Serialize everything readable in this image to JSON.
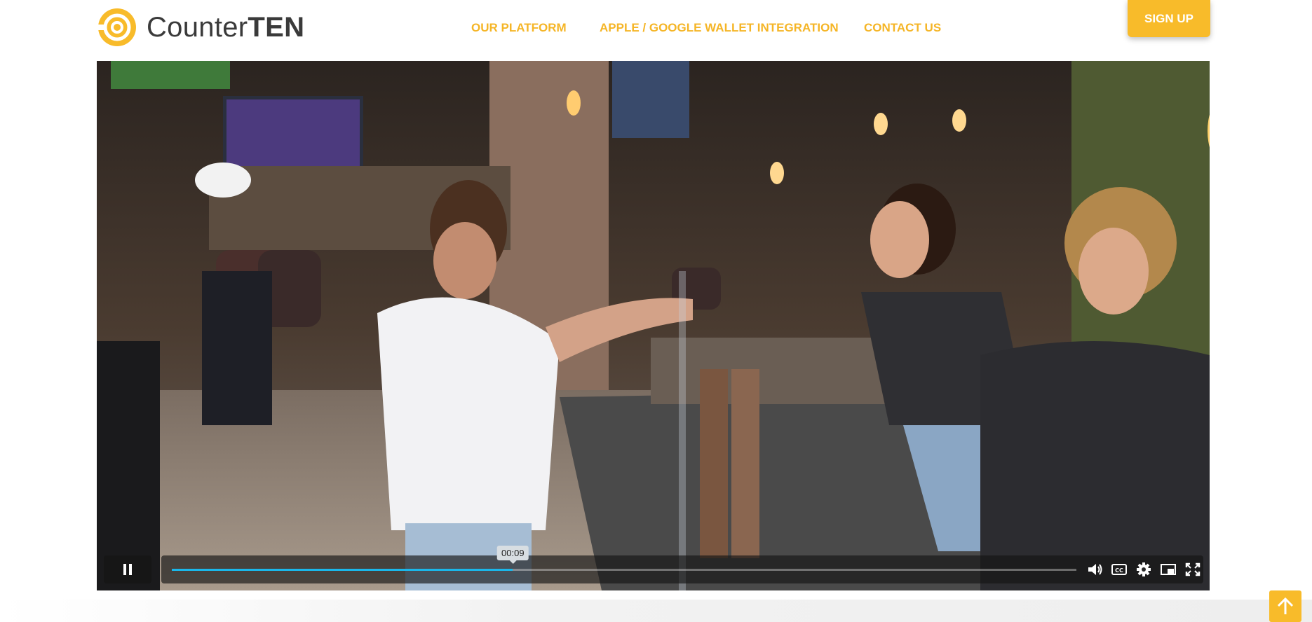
{
  "brand": {
    "name_part1": "Counter",
    "name_part2": "TEN",
    "accent": "#f8bb2a",
    "nav_color": "#f5b526",
    "logo_icon": "countertn-logo-icon"
  },
  "nav": {
    "items": [
      {
        "label": "OUR PLATFORM"
      },
      {
        "label": "APPLE / GOOGLE WALLET INTEGRATION"
      },
      {
        "label": "CONTACT US"
      }
    ],
    "signup_label": "SIGN UP"
  },
  "video": {
    "state": "playing",
    "progress_fraction": 0.377,
    "time_tooltip": "00:09",
    "progress_color": "#1ab7ea",
    "controls": {
      "pause_icon": "pause-icon",
      "volume_icon": "volume-icon",
      "captions_icon": "cc-icon",
      "settings_icon": "gear-icon",
      "pip_icon": "picture-in-picture-icon",
      "fullscreen_icon": "fullscreen-icon"
    }
  },
  "scroll_top": {
    "icon": "arrow-up-icon"
  }
}
